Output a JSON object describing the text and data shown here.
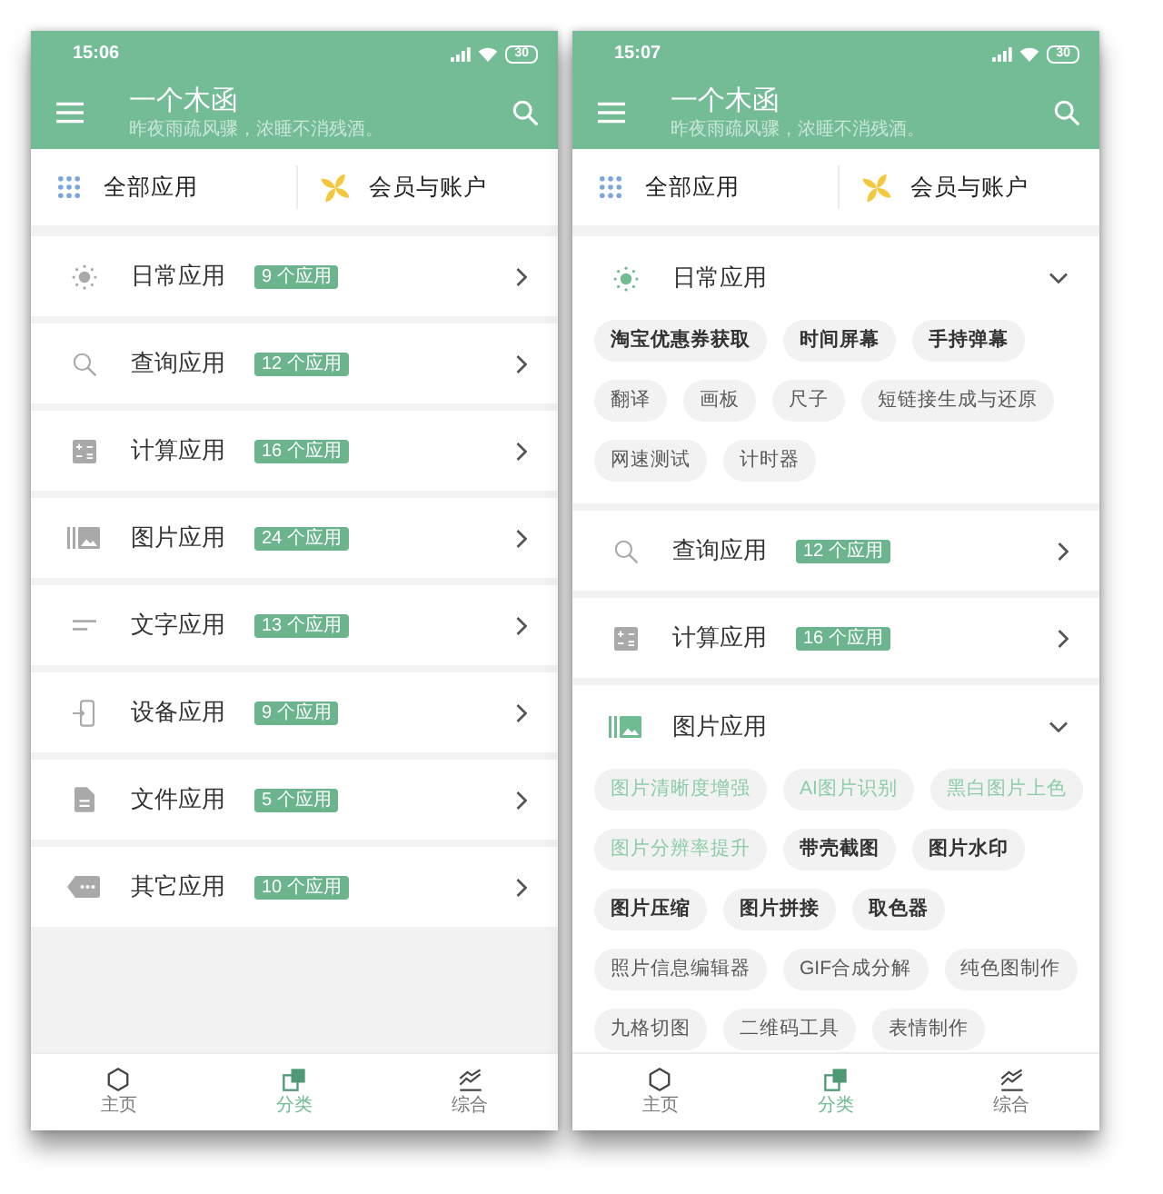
{
  "screens": [
    {
      "status_bar": {
        "time": "15:06",
        "battery": "30"
      },
      "app_bar": {
        "title": "一个木函",
        "subtitle": "昨夜雨疏风骤，浓睡不消残酒。"
      },
      "shortcuts": [
        {
          "label": "全部应用"
        },
        {
          "label": "会员与账户"
        }
      ],
      "categories": [
        {
          "name": "日常应用",
          "badge": "9 个应用",
          "expanded": false
        },
        {
          "name": "查询应用",
          "badge": "12 个应用",
          "expanded": false
        },
        {
          "name": "计算应用",
          "badge": "16 个应用",
          "expanded": false
        },
        {
          "name": "图片应用",
          "badge": "24 个应用",
          "expanded": false
        },
        {
          "name": "文字应用",
          "badge": "13 个应用",
          "expanded": false
        },
        {
          "name": "设备应用",
          "badge": "9 个应用",
          "expanded": false
        },
        {
          "name": "文件应用",
          "badge": "5 个应用",
          "expanded": false
        },
        {
          "name": "其它应用",
          "badge": "10 个应用",
          "expanded": false
        }
      ],
      "bottom_nav": [
        {
          "label": "主页",
          "selected": false
        },
        {
          "label": "分类",
          "selected": true
        },
        {
          "label": "综合",
          "selected": false
        }
      ]
    },
    {
      "status_bar": {
        "time": "15:07",
        "battery": "30"
      },
      "app_bar": {
        "title": "一个木函",
        "subtitle": "昨夜雨疏风骤，浓睡不消残酒。"
      },
      "shortcuts": [
        {
          "label": "全部应用"
        },
        {
          "label": "会员与账户"
        }
      ],
      "categories": [
        {
          "name": "日常应用",
          "expanded": true,
          "tags": [
            {
              "label": "淘宝优惠券获取",
              "kind": "bold"
            },
            {
              "label": "时间屏幕",
              "kind": "bold"
            },
            {
              "label": "手持弹幕",
              "kind": "bold"
            },
            {
              "label": "翻译",
              "kind": "plain"
            },
            {
              "label": "画板",
              "kind": "plain"
            },
            {
              "label": "尺子",
              "kind": "plain"
            },
            {
              "label": "短链接生成与还原",
              "kind": "plain"
            },
            {
              "label": "网速测试",
              "kind": "plain"
            },
            {
              "label": "计时器",
              "kind": "plain"
            }
          ]
        },
        {
          "name": "查询应用",
          "badge": "12 个应用",
          "expanded": false
        },
        {
          "name": "计算应用",
          "badge": "16 个应用",
          "expanded": false
        },
        {
          "name": "图片应用",
          "expanded": true,
          "tags": [
            {
              "label": "图片清晰度增强",
              "kind": "accent"
            },
            {
              "label": "AI图片识别",
              "kind": "accent"
            },
            {
              "label": "黑白图片上色",
              "kind": "accent"
            },
            {
              "label": "图片分辨率提升",
              "kind": "accent"
            },
            {
              "label": "带壳截图",
              "kind": "bold"
            },
            {
              "label": "图片水印",
              "kind": "bold"
            },
            {
              "label": "图片压缩",
              "kind": "bold"
            },
            {
              "label": "图片拼接",
              "kind": "bold"
            },
            {
              "label": "取色器",
              "kind": "bold"
            },
            {
              "label": "照片信息编辑器",
              "kind": "plain"
            },
            {
              "label": "GIF合成分解",
              "kind": "plain"
            },
            {
              "label": "纯色图制作",
              "kind": "plain"
            },
            {
              "label": "九格切图",
              "kind": "plain"
            },
            {
              "label": "二维码工具",
              "kind": "plain"
            },
            {
              "label": "表情制作",
              "kind": "plain"
            }
          ]
        }
      ],
      "bottom_nav": [
        {
          "label": "主页",
          "selected": false
        },
        {
          "label": "分类",
          "selected": true
        },
        {
          "label": "综合",
          "selected": false
        }
      ]
    }
  ]
}
